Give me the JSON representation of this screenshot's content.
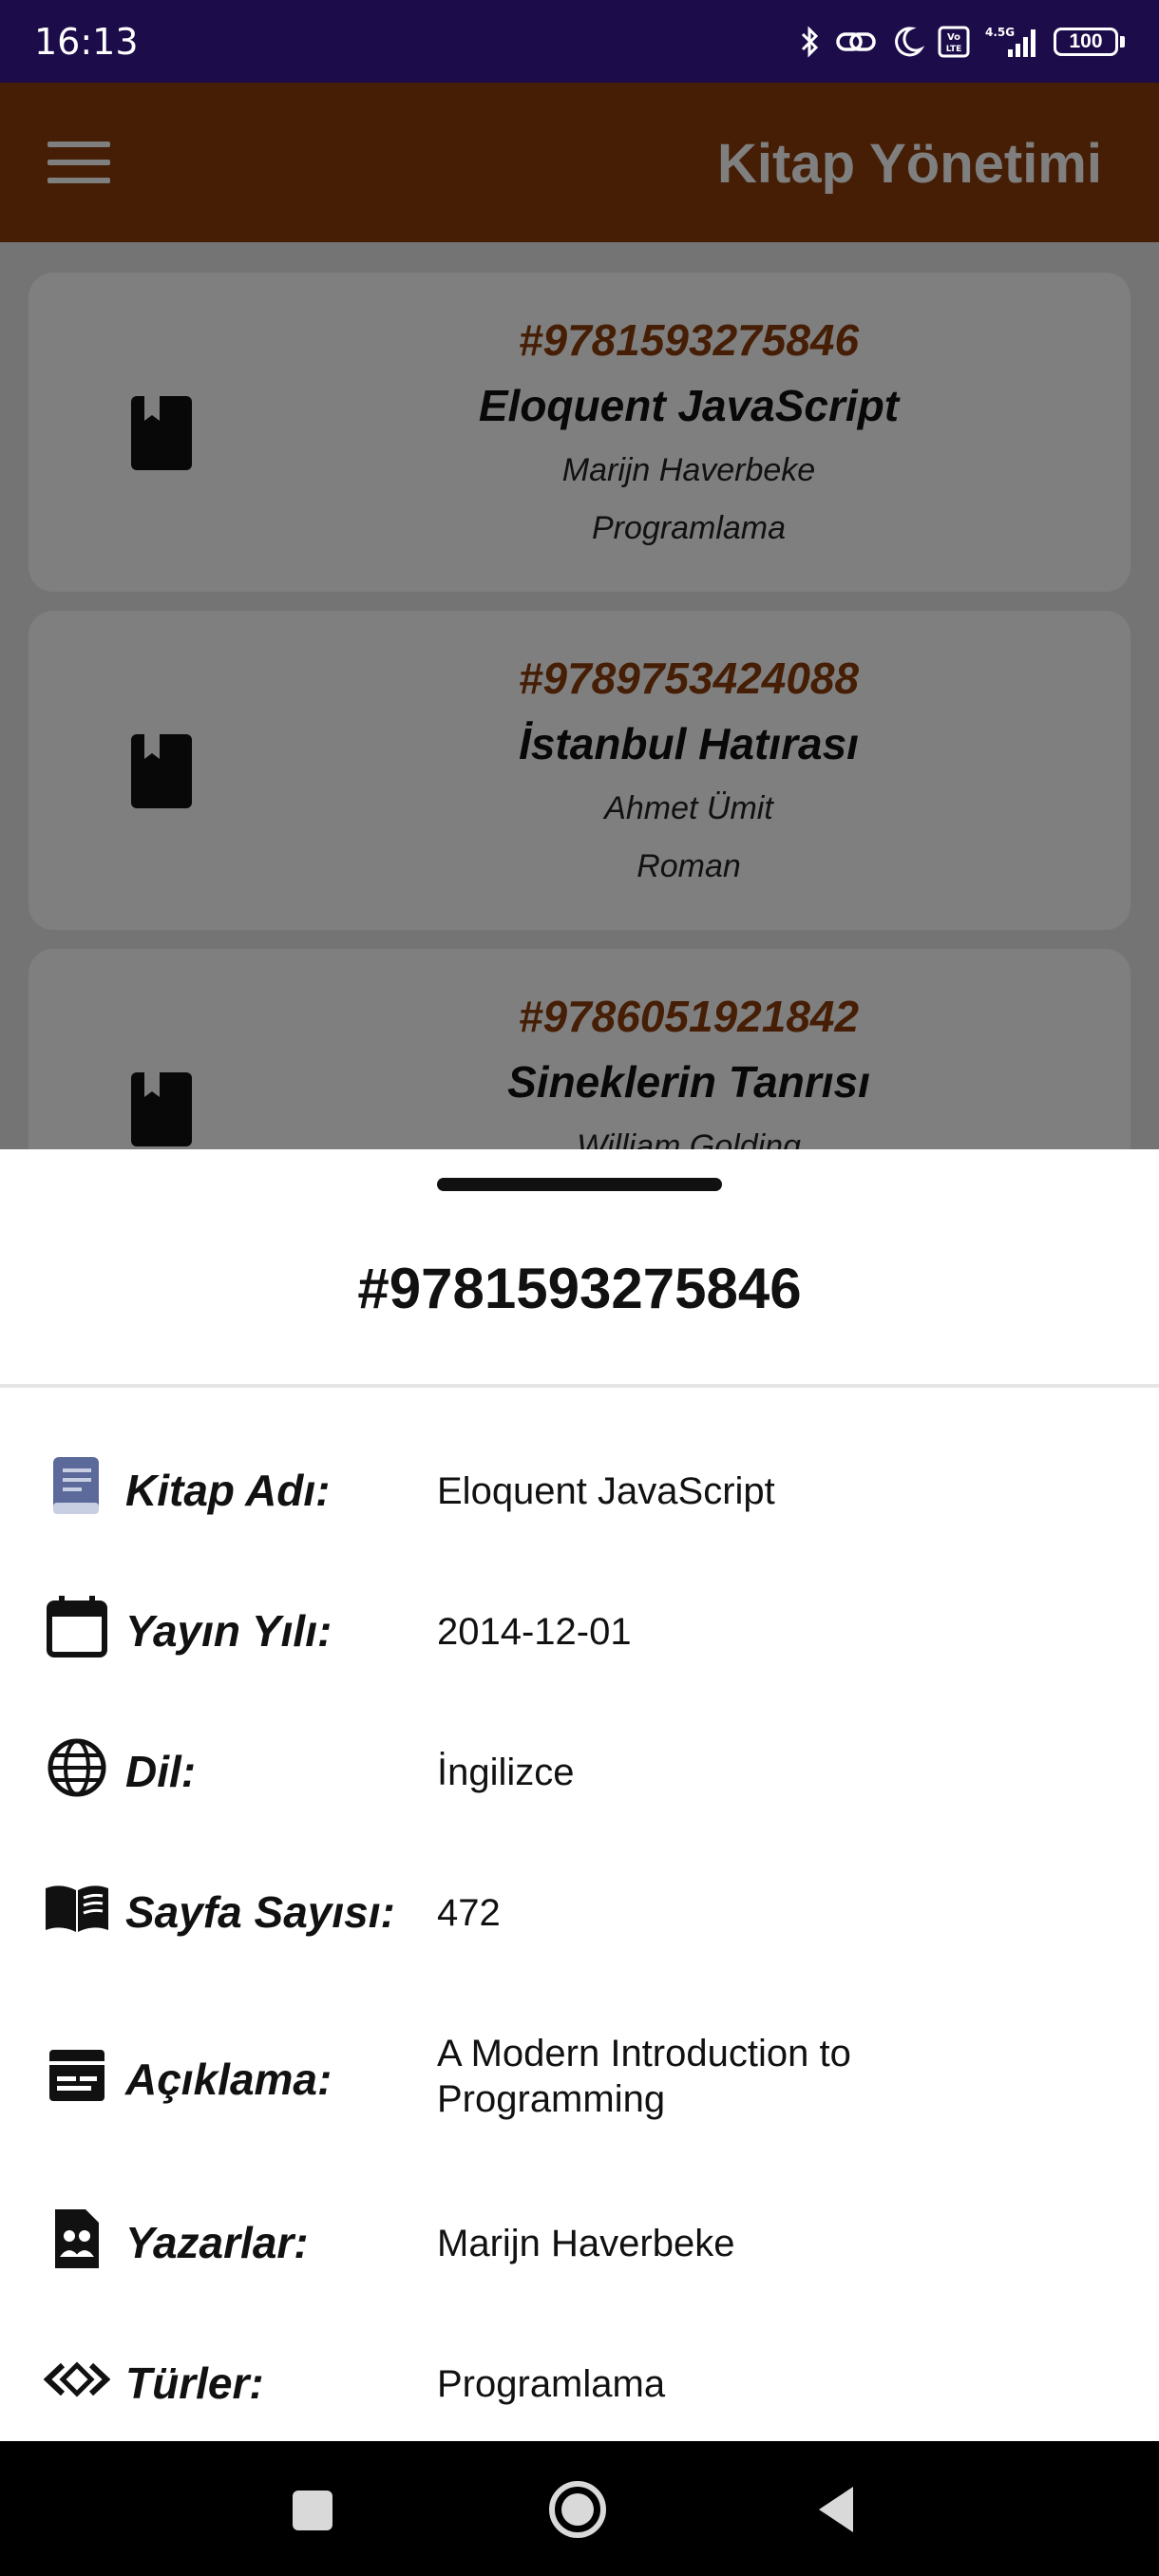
{
  "status_bar": {
    "time": "16:13",
    "network": "4.5G",
    "battery": "100"
  },
  "app_bar": {
    "title": "Kitap Yönetimi",
    "menu_icon": "menu-icon"
  },
  "colors": {
    "brand": "#8a3d0a",
    "status_bar": "#1c0c4a"
  },
  "books": [
    {
      "isbn": "#9781593275846",
      "title": "Eloquent JavaScript",
      "author": "Marijn Haverbeke",
      "genre": "Programlama"
    },
    {
      "isbn": "#9789753424088",
      "title": "İstanbul Hatırası",
      "author": "Ahmet Ümit",
      "genre": "Roman"
    },
    {
      "isbn": "#9786051921842",
      "title": "Sineklerin Tanrısı",
      "author": "William Golding",
      "genre": ""
    }
  ],
  "sheet": {
    "heading": "#9781593275846",
    "rows": [
      {
        "icon": "book-icon",
        "label": "Kitap Adı:",
        "value": "Eloquent JavaScript"
      },
      {
        "icon": "calendar-icon",
        "label": "Yayın Yılı:",
        "value": "2014-12-01"
      },
      {
        "icon": "globe-icon",
        "label": "Dil:",
        "value": "İngilizce"
      },
      {
        "icon": "open-book-icon",
        "label": "Sayfa Sayısı:",
        "value": "472"
      },
      {
        "icon": "description-icon",
        "label": "Açıklama:",
        "value": "A Modern Introduction to Programming"
      },
      {
        "icon": "author-icon",
        "label": "Yazarlar:",
        "value": "Marijn Haverbeke"
      },
      {
        "icon": "code-icon",
        "label": "Türler:",
        "value": "Programlama"
      }
    ]
  },
  "nav_bar": {
    "buttons": [
      "recents-button",
      "home-button",
      "back-button"
    ]
  }
}
